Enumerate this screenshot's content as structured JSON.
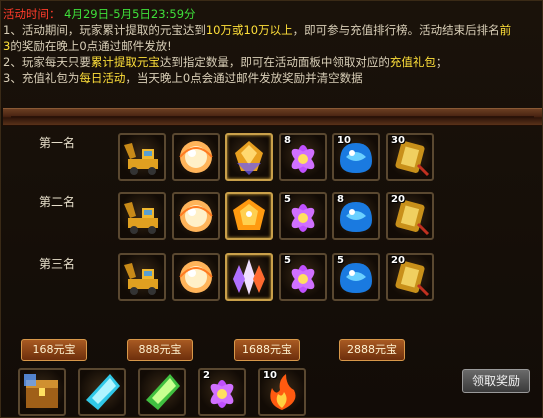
{
  "activity": {
    "time_label": "活动时间：",
    "time_range": "4月29日-5月5日23:59分",
    "rule1_prefix": "1、活动期间，玩家累计提取的元宝达到",
    "rule1_amount": "10万或10万以上",
    "rule1_mid": "，即可参与充值排行榜。活动结束后排名",
    "rule1_front": "前",
    "rule1_line2_prefix": "3",
    "rule1_line2": "的奖励在晚上0点通过邮件发放!",
    "rule2_prefix": "2、玩家每天只要",
    "rule2_highlight": "累计提取元宝",
    "rule2_mid": "达到指定数量，即可在活动面板中领取对应的",
    "rule2_gift": "充值礼包",
    "rule2_end": "；",
    "rule3_prefix": "3、充值礼包为",
    "rule3_daily": "每日活动",
    "rule3_end": "，当天晚上0点会通过邮件发放奖励并清空数据"
  },
  "ranks": [
    {
      "label": "第一名",
      "items": [
        {
          "icon": "excavator-icon",
          "count": ""
        },
        {
          "icon": "gold-orb-icon",
          "count": ""
        },
        {
          "icon": "gold-gem-icon",
          "count": ""
        },
        {
          "icon": "purple-lotus-icon",
          "count": "8"
        },
        {
          "icon": "blue-gem-icon",
          "count": "10"
        },
        {
          "icon": "gold-talisman-icon",
          "count": "30"
        }
      ]
    },
    {
      "label": "第二名",
      "items": [
        {
          "icon": "excavator-icon",
          "count": ""
        },
        {
          "icon": "gold-orb-icon",
          "count": ""
        },
        {
          "icon": "amber-gem-icon",
          "count": ""
        },
        {
          "icon": "purple-lotus-icon",
          "count": "5"
        },
        {
          "icon": "blue-gem-icon",
          "count": "8"
        },
        {
          "icon": "gold-talisman-icon",
          "count": "20"
        }
      ]
    },
    {
      "label": "第三名",
      "items": [
        {
          "icon": "excavator-icon",
          "count": ""
        },
        {
          "icon": "gold-orb-icon",
          "count": ""
        },
        {
          "icon": "crystal-shard-icon",
          "count": ""
        },
        {
          "icon": "purple-lotus-icon",
          "count": "5"
        },
        {
          "icon": "blue-gem-icon",
          "count": "5"
        },
        {
          "icon": "gold-talisman-icon",
          "count": "20"
        }
      ]
    }
  ],
  "tiers": [
    {
      "label": "168元宝"
    },
    {
      "label": "888元宝"
    },
    {
      "label": "1688元宝"
    },
    {
      "label": "2888元宝"
    }
  ],
  "daily_rewards": [
    {
      "icon": "treasure-box-icon",
      "count": ""
    },
    {
      "icon": "cyan-crystal-icon",
      "count": ""
    },
    {
      "icon": "green-crystal-icon",
      "count": ""
    },
    {
      "icon": "purple-lotus-icon",
      "count": "2"
    },
    {
      "icon": "flame-icon",
      "count": "10"
    }
  ],
  "claim_button": "领取奖励",
  "colors": {
    "red": "#ff3b2a",
    "green": "#3fe03a",
    "yellow": "#ffe03a",
    "body_text": "#d9cfb8",
    "tier_button": "#a85a22"
  }
}
